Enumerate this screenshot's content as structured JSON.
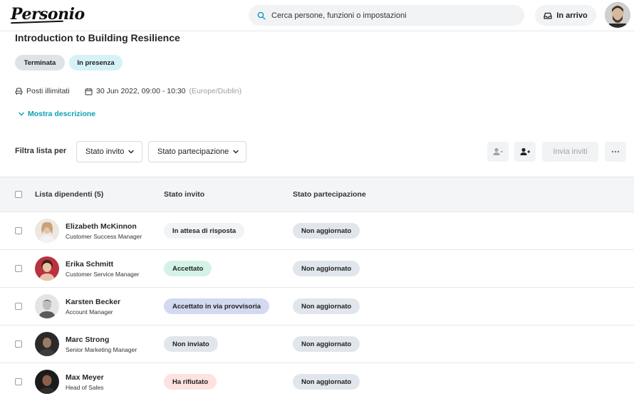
{
  "header": {
    "logo": "Personio",
    "search_placeholder": "Cerca persone, funzioni o impostazioni",
    "inbox_label": "In arrivo"
  },
  "event": {
    "title": "Introduction to Building Resilience",
    "status_pill": "Terminata",
    "mode_pill": "In presenza",
    "seats": "Posti illimitati",
    "datetime": "30 Jun 2022, 09:00 - 10:30",
    "timezone": "(Europe/Dublin)",
    "show_description": "Mostra descrizione"
  },
  "filters": {
    "label": "Filtra lista per",
    "invite_status": "Stato invito",
    "participation_status": "Stato partecipazione",
    "send_invites": "Invia inviti"
  },
  "table": {
    "columns": [
      "Lista dipendenti (5)",
      "Stato invito",
      "Stato partecipazione"
    ],
    "rows": [
      {
        "name": "Elizabeth McKinnon",
        "role": "Customer Success Manager",
        "invite": "In attesa di risposta",
        "participation": "Non aggiornato"
      },
      {
        "name": "Erika Schmitt",
        "role": "Customer Service Manager",
        "invite": "Accettato",
        "participation": "Non aggiornato"
      },
      {
        "name": "Karsten Becker",
        "role": "Account Manager",
        "invite": "Accettato in via provvisoria",
        "participation": "Non aggiornato"
      },
      {
        "name": "Marc Strong",
        "role": "Senior Marketing Manager",
        "invite": "Non inviato",
        "participation": "Non aggiornato"
      },
      {
        "name": "Max Meyer",
        "role": "Head of Sales",
        "invite": "Ha rifiutato",
        "participation": "Non aggiornato"
      }
    ]
  },
  "colors": {
    "accent": "#0a9fb5",
    "pending": "#f1f3f5",
    "accepted": "#d4f3e6",
    "tentative": "#d3d9f0",
    "not_sent": "#e1e6ec",
    "declined": "#fde2df"
  }
}
